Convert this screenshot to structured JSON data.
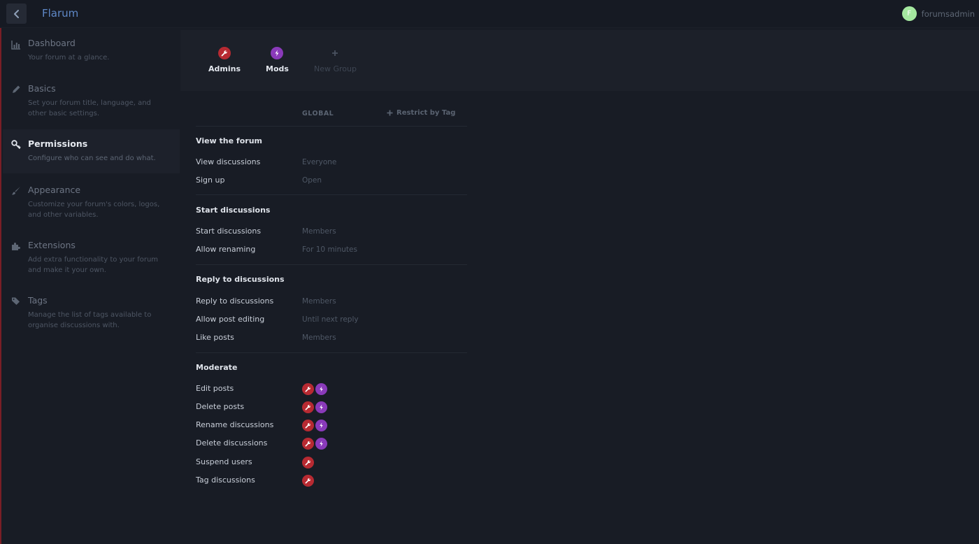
{
  "header": {
    "title": "Flarum",
    "user": {
      "initial": "F",
      "name": "forumsadmin",
      "avatar_color": "#a5e8a0"
    }
  },
  "sidebar": {
    "items": [
      {
        "label": "Dashboard",
        "desc": "Your forum at a glance.",
        "icon": "chart-icon"
      },
      {
        "label": "Basics",
        "desc": "Set your forum title, language, and other basic settings.",
        "icon": "pencil-icon"
      },
      {
        "label": "Permissions",
        "desc": "Configure who can see and do what.",
        "icon": "key-icon",
        "active": true
      },
      {
        "label": "Appearance",
        "desc": "Customize your forum's colors, logos, and other variables.",
        "icon": "paint-brush-icon"
      },
      {
        "label": "Extensions",
        "desc": "Add extra functionality to your forum and make it your own.",
        "icon": "puzzle-icon"
      },
      {
        "label": "Tags",
        "desc": "Manage the list of tags available to organise discussions with.",
        "icon": "tags-icon"
      }
    ]
  },
  "groups": {
    "items": [
      {
        "label": "Admins",
        "icon": "wrench-icon",
        "color": "#b72a32"
      },
      {
        "label": "Mods",
        "icon": "bolt-icon",
        "color": "#8a3aba"
      }
    ],
    "new_group": "New Group"
  },
  "permissions": {
    "global_header": "GLOBAL",
    "restrict_label": "Restrict by Tag",
    "sections": {
      "view": {
        "title": "View the forum",
        "rows": [
          {
            "label": "View discussions",
            "value": "Everyone"
          },
          {
            "label": "Sign up",
            "value": "Open"
          }
        ]
      },
      "start": {
        "title": "Start discussions",
        "rows": [
          {
            "label": "Start discussions",
            "value": "Members"
          },
          {
            "label": "Allow renaming",
            "value": "For 10 minutes"
          }
        ]
      },
      "reply": {
        "title": "Reply to discussions",
        "rows": [
          {
            "label": "Reply to discussions",
            "value": "Members"
          },
          {
            "label": "Allow post editing",
            "value": "Until next reply"
          },
          {
            "label": "Like posts",
            "value": "Members"
          }
        ]
      },
      "moderate": {
        "title": "Moderate",
        "rows": [
          {
            "label": "Edit posts",
            "groups": [
              "Admins",
              "Mods"
            ]
          },
          {
            "label": "Delete posts",
            "groups": [
              "Admins",
              "Mods"
            ]
          },
          {
            "label": "Rename discussions",
            "groups": [
              "Admins",
              "Mods"
            ]
          },
          {
            "label": "Delete discussions",
            "groups": [
              "Admins",
              "Mods"
            ]
          },
          {
            "label": "Suspend users",
            "groups": [
              "Admins"
            ]
          },
          {
            "label": "Tag discussions",
            "groups": [
              "Admins"
            ]
          }
        ]
      }
    }
  }
}
